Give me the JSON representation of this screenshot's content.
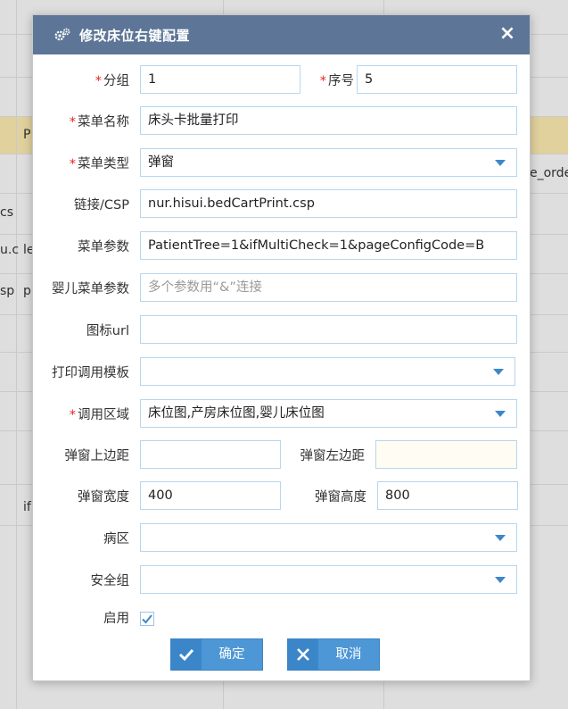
{
  "background": {
    "fragments": [
      "P",
      "e_orde",
      "cs",
      "u.c",
      "le",
      "sp",
      "p",
      "if"
    ]
  },
  "dialog": {
    "title": "修改床位右键配置",
    "close_glyph": "×",
    "required_mark": "*",
    "fields": {
      "group": {
        "label": "分组",
        "value": "1"
      },
      "order": {
        "label": "序号",
        "value": "5"
      },
      "menu_name": {
        "label": "菜单名称",
        "value": "床头卡批量打印"
      },
      "menu_type": {
        "label": "菜单类型",
        "value": "弹窗"
      },
      "link": {
        "label": "链接/CSP",
        "value": "nur.hisui.bedCartPrint.csp"
      },
      "menu_params": {
        "label": "菜单参数",
        "value": "PatientTree=1&ifMultiCheck=1&pageConfigCode=B"
      },
      "baby_params": {
        "label": "婴儿菜单参数",
        "placeholder": "多个参数用“&”连接"
      },
      "icon_url": {
        "label": "图标url",
        "value": ""
      },
      "print_template": {
        "label": "打印调用模板",
        "value": ""
      },
      "call_area": {
        "label": "调用区域",
        "value": "床位图,产房床位图,婴儿床位图"
      },
      "popup_top": {
        "label": "弹窗上边距",
        "value": ""
      },
      "popup_left": {
        "label": "弹窗左边距",
        "value": ""
      },
      "popup_width": {
        "label": "弹窗宽度",
        "value": "400"
      },
      "popup_height": {
        "label": "弹窗高度",
        "value": "800"
      },
      "ward": {
        "label": "病区",
        "value": ""
      },
      "security_group": {
        "label": "安全组",
        "value": ""
      },
      "enabled": {
        "label": "启用",
        "checked": true
      }
    },
    "buttons": {
      "ok": "确定",
      "cancel": "取消"
    }
  },
  "colors": {
    "titlebar": "#5d7697",
    "button": "#4e97d6",
    "required": "#e42525",
    "field_border": "#b7d6ee"
  }
}
